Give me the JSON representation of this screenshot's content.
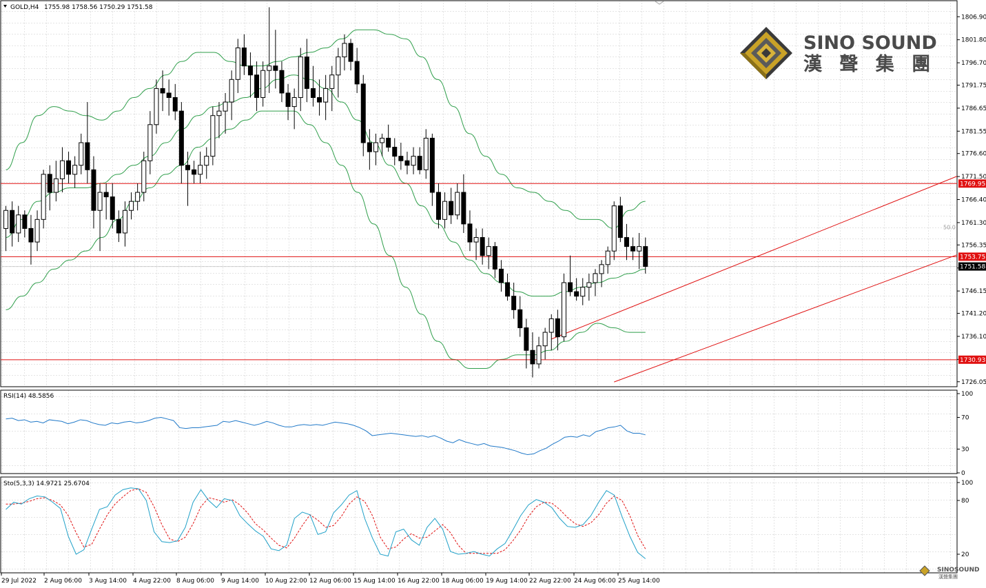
{
  "header": {
    "symbol": "GOLD,H4",
    "ohlc": "1755.98 1758.56 1750.29 1751.58"
  },
  "logo": {
    "name_en": "SINO SOUND",
    "name_zh": "漢 聲 集 團",
    "small_en": "SINOSOUND",
    "small_zh": "漢聲集團"
  },
  "colors": {
    "bullish": "#ffffff",
    "bearish": "#000000",
    "bands": "#2e9e4a",
    "level_lines": "#e01010",
    "channel": "#e01010",
    "rsi": "#1f78c8",
    "sto_main": "#1fa0c8",
    "sto_signal": "#e01010",
    "grid": "#c8c8c8"
  },
  "chart_data": [
    {
      "type": "candlestick",
      "title": "GOLD,H4",
      "yticks": [
        "1806.90",
        "1801.80",
        "1796.70",
        "1791.75",
        "1786.65",
        "1781.55",
        "1776.60",
        "1771.50",
        "1766.40",
        "1761.30",
        "1756.35",
        "1751.25",
        "1746.15",
        "1741.20",
        "1736.10",
        "1731.00",
        "1726.05"
      ],
      "ylim": [
        1725.1,
        1810.3
      ],
      "xticks": [
        "29 Jul 2022",
        "2 Aug 06:00",
        "3 Aug 14:00",
        "4 Aug 22:00",
        "8 Aug 06:00",
        "9 Aug 14:00",
        "10 Aug 22:00",
        "12 Aug 06:00",
        "15 Aug 14:00",
        "16 Aug 22:00",
        "18 Aug 06:00",
        "19 Aug 14:00",
        "22 Aug 22:00",
        "24 Aug 06:00",
        "25 Aug 14:00"
      ],
      "levels": [
        {
          "label": "1769.95",
          "value": 1769.95
        },
        {
          "label": "1753.75",
          "value": 1753.75
        },
        {
          "label": "1730.93",
          "value": 1730.93
        }
      ],
      "current_price": "1751.58",
      "level_marker": "50.0",
      "channel_lines": [
        {
          "from": [
            87,
            1735.5
          ],
          "to": [
            174,
            1784.0
          ]
        },
        {
          "from": [
            97,
            1726.0
          ],
          "to": [
            184,
            1770.8
          ]
        }
      ],
      "candles": [
        [
          1760,
          1765,
          1755,
          1764
        ],
        [
          1764,
          1766,
          1756,
          1759
        ],
        [
          1759,
          1765,
          1757,
          1763
        ],
        [
          1763,
          1764,
          1758,
          1760
        ],
        [
          1760,
          1763,
          1752,
          1757
        ],
        [
          1757,
          1764,
          1755,
          1762
        ],
        [
          1762,
          1773,
          1760,
          1772
        ],
        [
          1772,
          1774,
          1764,
          1768
        ],
        [
          1768,
          1775,
          1766,
          1771
        ],
        [
          1771,
          1778,
          1768,
          1775
        ],
        [
          1775,
          1777,
          1770,
          1772
        ],
        [
          1772,
          1776,
          1769,
          1774
        ],
        [
          1774,
          1781,
          1772,
          1779
        ],
        [
          1779,
          1788,
          1770,
          1773
        ],
        [
          1773,
          1776,
          1760,
          1764
        ],
        [
          1764,
          1770,
          1755,
          1768
        ],
        [
          1768,
          1770,
          1762,
          1767
        ],
        [
          1767,
          1770,
          1760,
          1762
        ],
        [
          1762,
          1764,
          1757,
          1759
        ],
        [
          1759,
          1766,
          1756,
          1764
        ],
        [
          1764,
          1768,
          1762,
          1766
        ],
        [
          1766,
          1770,
          1764,
          1768
        ],
        [
          1768,
          1777,
          1766,
          1775
        ],
        [
          1775,
          1786,
          1772,
          1783
        ],
        [
          1783,
          1793,
          1781,
          1791
        ],
        [
          1791,
          1795,
          1786,
          1790
        ],
        [
          1790,
          1793,
          1785,
          1789
        ],
        [
          1789,
          1792,
          1784,
          1786
        ],
        [
          1786,
          1788,
          1770,
          1774
        ],
        [
          1774,
          1777,
          1765,
          1773
        ],
        [
          1773,
          1775,
          1770,
          1772
        ],
        [
          1772,
          1777,
          1770,
          1774
        ],
        [
          1774,
          1778,
          1771,
          1776
        ],
        [
          1776,
          1787,
          1774,
          1785
        ],
        [
          1785,
          1788,
          1780,
          1786
        ],
        [
          1786,
          1790,
          1781,
          1788
        ],
        [
          1788,
          1795,
          1784,
          1793
        ],
        [
          1793,
          1802,
          1790,
          1800
        ],
        [
          1800,
          1803,
          1794,
          1796
        ],
        [
          1796,
          1799,
          1789,
          1794
        ],
        [
          1794,
          1797,
          1786,
          1789
        ],
        [
          1789,
          1797,
          1787,
          1795
        ],
        [
          1795,
          1809,
          1790,
          1796
        ],
        [
          1796,
          1804,
          1791,
          1795
        ],
        [
          1795,
          1797,
          1788,
          1790
        ],
        [
          1790,
          1792,
          1784,
          1787
        ],
        [
          1787,
          1791,
          1782,
          1789
        ],
        [
          1789,
          1800,
          1786,
          1798
        ],
        [
          1798,
          1802,
          1788,
          1791
        ],
        [
          1791,
          1796,
          1787,
          1789
        ],
        [
          1789,
          1793,
          1785,
          1788
        ],
        [
          1788,
          1794,
          1784,
          1791
        ],
        [
          1791,
          1796,
          1786,
          1794
        ],
        [
          1794,
          1800,
          1789,
          1798
        ],
        [
          1798,
          1803,
          1795,
          1801
        ],
        [
          1801,
          1802,
          1795,
          1797
        ],
        [
          1797,
          1800,
          1790,
          1792
        ],
        [
          1792,
          1794,
          1776,
          1779
        ],
        [
          1779,
          1782,
          1773,
          1777
        ],
        [
          1777,
          1781,
          1774,
          1779
        ],
        [
          1779,
          1781,
          1776,
          1780
        ],
        [
          1780,
          1783,
          1777,
          1778
        ],
        [
          1778,
          1780,
          1774,
          1776
        ],
        [
          1776,
          1779,
          1773,
          1775
        ],
        [
          1775,
          1777,
          1772,
          1774
        ],
        [
          1774,
          1778,
          1772,
          1776
        ],
        [
          1776,
          1778,
          1772,
          1773
        ],
        [
          1773,
          1782,
          1771,
          1780
        ],
        [
          1780,
          1781,
          1765,
          1768
        ],
        [
          1768,
          1770,
          1760,
          1762
        ],
        [
          1762,
          1768,
          1760,
          1766
        ],
        [
          1766,
          1769,
          1761,
          1763
        ],
        [
          1763,
          1770,
          1762,
          1768
        ],
        [
          1768,
          1772,
          1759,
          1761
        ],
        [
          1761,
          1764,
          1755,
          1757
        ],
        [
          1757,
          1760,
          1753,
          1758
        ],
        [
          1758,
          1760,
          1752,
          1754
        ],
        [
          1754,
          1758,
          1751,
          1756
        ],
        [
          1756,
          1757,
          1749,
          1751
        ],
        [
          1751,
          1753,
          1746,
          1748
        ],
        [
          1748,
          1750,
          1744,
          1745
        ],
        [
          1745,
          1748,
          1740,
          1742
        ],
        [
          1742,
          1745,
          1736,
          1738
        ],
        [
          1738,
          1740,
          1729,
          1733
        ],
        [
          1733,
          1737,
          1727,
          1730
        ],
        [
          1730,
          1736,
          1729,
          1734
        ],
        [
          1734,
          1738,
          1731,
          1737
        ],
        [
          1737,
          1741,
          1733,
          1740
        ],
        [
          1740,
          1742,
          1733,
          1736
        ],
        [
          1736,
          1750,
          1735,
          1748
        ],
        [
          1748,
          1754,
          1745,
          1746
        ],
        [
          1746,
          1749,
          1744,
          1745
        ],
        [
          1745,
          1749,
          1743,
          1747
        ],
        [
          1747,
          1750,
          1744,
          1748
        ],
        [
          1748,
          1751,
          1745,
          1750
        ],
        [
          1750,
          1753,
          1747,
          1752
        ],
        [
          1752,
          1756,
          1750,
          1755
        ],
        [
          1755,
          1766,
          1753,
          1765
        ],
        [
          1765,
          1767,
          1757,
          1758
        ],
        [
          1758,
          1761,
          1753,
          1756
        ],
        [
          1756,
          1758,
          1753,
          1755
        ],
        [
          1755,
          1759,
          1751,
          1756
        ],
        [
          1756,
          1758,
          1750,
          1751.58
        ]
      ],
      "bb_upper": [
        1773,
        1779,
        1785,
        1787,
        1786,
        1785,
        1784,
        1786,
        1789,
        1791,
        1794,
        1797,
        1799,
        1799,
        1797,
        1796,
        1796,
        1797,
        1798,
        1799,
        1800,
        1802,
        1804,
        1804,
        1803,
        1802,
        1798,
        1793,
        1787,
        1781,
        1776,
        1772,
        1769,
        1768,
        1766,
        1764,
        1762,
        1762,
        1760,
        1764,
        1766
      ],
      "bb_mid": [
        1758,
        1762,
        1766,
        1768,
        1769,
        1769,
        1770,
        1772,
        1774,
        1776,
        1779,
        1782,
        1785,
        1787,
        1788,
        1789,
        1791,
        1793,
        1794,
        1793,
        1791,
        1788,
        1784,
        1779,
        1774,
        1770,
        1765,
        1761,
        1757,
        1753,
        1750,
        1748,
        1746,
        1745,
        1745,
        1746,
        1747,
        1748,
        1749,
        1750,
        1751
      ],
      "bb_lower": [
        1742,
        1745,
        1748,
        1751,
        1753,
        1755,
        1758,
        1762,
        1766,
        1769,
        1772,
        1774,
        1778,
        1780,
        1782,
        1784,
        1786,
        1786,
        1786,
        1783,
        1779,
        1774,
        1768,
        1761,
        1754,
        1747,
        1741,
        1735,
        1731,
        1729,
        1729,
        1731,
        1732,
        1732,
        1733,
        1735,
        1737,
        1739,
        1738,
        1737,
        1737
      ],
      "rsi": {
        "label": "RSI(14) 48.5856",
        "yticks": [
          "100",
          "70",
          "30",
          "0"
        ],
        "ylim": [
          0,
          100
        ],
        "values": [
          68,
          69,
          66,
          67,
          64,
          65,
          63,
          67,
          66,
          65,
          62,
          64,
          67,
          66,
          63,
          61,
          60,
          63,
          62,
          64,
          65,
          63,
          64,
          66,
          69,
          70,
          68,
          66,
          57,
          56,
          57,
          57,
          58,
          59,
          60,
          65,
          64,
          66,
          64,
          62,
          60,
          62,
          65,
          63,
          60,
          58,
          58,
          60,
          61,
          60,
          61,
          60,
          62,
          64,
          63,
          62,
          60,
          57,
          53,
          47,
          48,
          49,
          50,
          49,
          48,
          47,
          46,
          47,
          45,
          47,
          44,
          40,
          38,
          42,
          39,
          37,
          35,
          37,
          34,
          33,
          32,
          30,
          28,
          25,
          23,
          24,
          28,
          31,
          36,
          40,
          45,
          46,
          45,
          48,
          46,
          52,
          54,
          57,
          58,
          60,
          53,
          50,
          50,
          48
        ]
      },
      "stochastic": {
        "label": "Sto(5,3,3) 14.9721 25.6704",
        "yticks": [
          "100",
          "80",
          "20"
        ],
        "ylim": [
          0,
          100
        ],
        "main": [
          70,
          78,
          76,
          82,
          85,
          84,
          78,
          71,
          40,
          20,
          25,
          48,
          70,
          73,
          86,
          92,
          94,
          93,
          80,
          45,
          34,
          33,
          35,
          50,
          78,
          92,
          80,
          72,
          82,
          80,
          63,
          54,
          46,
          40,
          26,
          24,
          30,
          60,
          67,
          64,
          42,
          45,
          66,
          75,
          86,
          91,
          60,
          38,
          20,
          18,
          45,
          48,
          36,
          30,
          50,
          60,
          48,
          23,
          20,
          21,
          23,
          20,
          18,
          26,
          32,
          47,
          63,
          75,
          81,
          78,
          72,
          60,
          51,
          50,
          53,
          63,
          78,
          91,
          86,
          62,
          40,
          22,
          15
        ],
        "signal": [
          76,
          76,
          77,
          79,
          82,
          83,
          80,
          75,
          63,
          44,
          28,
          31,
          48,
          64,
          76,
          84,
          91,
          93,
          89,
          73,
          53,
          37,
          34,
          39,
          54,
          73,
          83,
          81,
          78,
          81,
          75,
          66,
          54,
          47,
          38,
          30,
          27,
          38,
          52,
          64,
          58,
          50,
          52,
          62,
          76,
          84,
          79,
          63,
          39,
          26,
          28,
          37,
          43,
          38,
          39,
          46,
          53,
          44,
          30,
          21,
          21,
          21,
          21,
          21,
          25,
          35,
          47,
          62,
          73,
          78,
          77,
          70,
          61,
          54,
          51,
          55,
          64,
          77,
          85,
          80,
          63,
          41,
          26
        ]
      }
    }
  ]
}
